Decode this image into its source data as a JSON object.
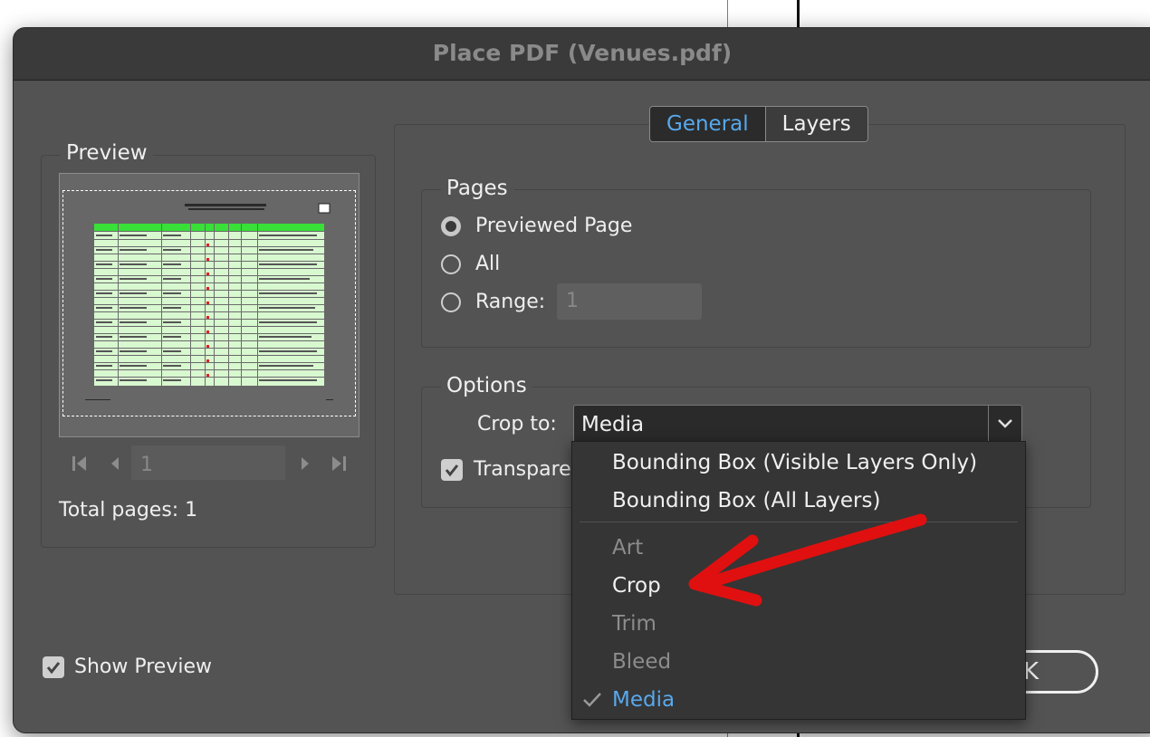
{
  "dialog": {
    "title": "Place PDF (Venues.pdf)"
  },
  "tabs": [
    {
      "label": "General",
      "active": true
    },
    {
      "label": "Layers",
      "active": false
    }
  ],
  "preview": {
    "legend": "Preview",
    "page_number": "1",
    "total_pages": "Total pages: 1",
    "show_preview_label": "Show Preview",
    "show_preview_checked": true
  },
  "pages": {
    "legend": "Pages",
    "options": [
      {
        "label": "Previewed Page",
        "selected": true
      },
      {
        "label": "All",
        "selected": false
      },
      {
        "label": "Range:",
        "selected": false
      }
    ],
    "range_value": "1"
  },
  "options": {
    "legend": "Options",
    "crop_to_label": "Crop to:",
    "crop_to_value": "Media",
    "transparent_label": "Transpare",
    "transparent_checked": true
  },
  "dropdown": {
    "items": [
      {
        "label": "Bounding Box (Visible Layers Only)",
        "state": "enabled"
      },
      {
        "label": "Bounding Box (All Layers)",
        "state": "enabled"
      },
      {
        "label": "Art",
        "state": "disabled"
      },
      {
        "label": "Crop",
        "state": "enabled"
      },
      {
        "label": "Trim",
        "state": "disabled"
      },
      {
        "label": "Bleed",
        "state": "disabled"
      },
      {
        "label": "Media",
        "state": "selected"
      }
    ]
  },
  "ok_button": {
    "label_partial": "K"
  },
  "colors": {
    "accent": "#58a8ec",
    "annotation_arrow": "#e01010",
    "dialog_bg": "#535353"
  }
}
